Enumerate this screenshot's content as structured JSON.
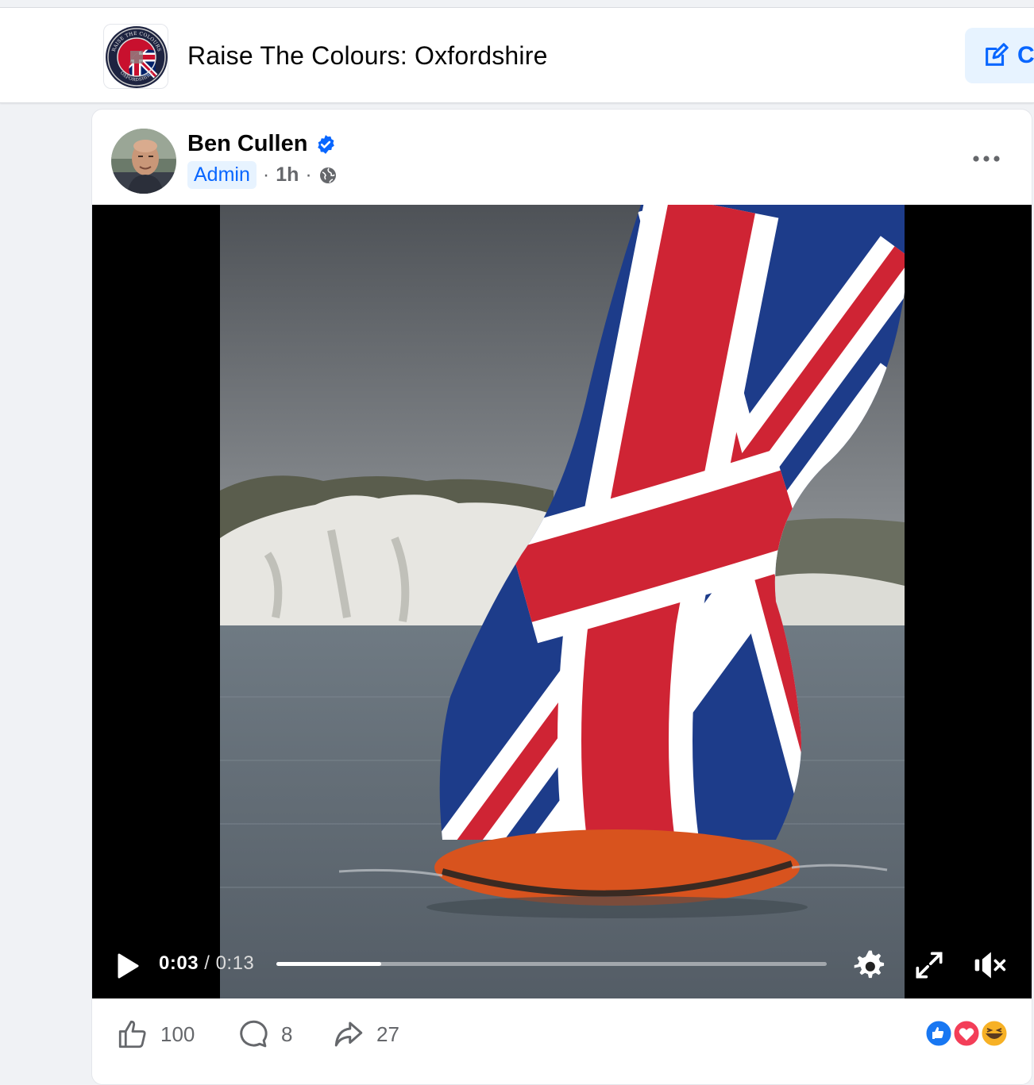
{
  "group": {
    "title": "Raise The Colours: Oxfordshire",
    "avatar_top_text": "RAISE THE COLOURS",
    "avatar_bottom_text": "OXFORDSHIRE",
    "edit_label": "C"
  },
  "post": {
    "author": "Ben Cullen",
    "role_badge": "Admin",
    "separator": "·",
    "time": "1h",
    "privacy_icon": "globe-icon"
  },
  "video": {
    "current_time": "0:03",
    "slash": "/",
    "duration": "0:13",
    "progress_fraction": 0.19
  },
  "actions": {
    "like_count": "100",
    "comment_count": "8",
    "share_count": "27"
  },
  "colors": {
    "accent": "#0866ff",
    "like_blue": "#1877f2",
    "love_red": "#f33e58",
    "haha_yellow": "#f7b125"
  }
}
